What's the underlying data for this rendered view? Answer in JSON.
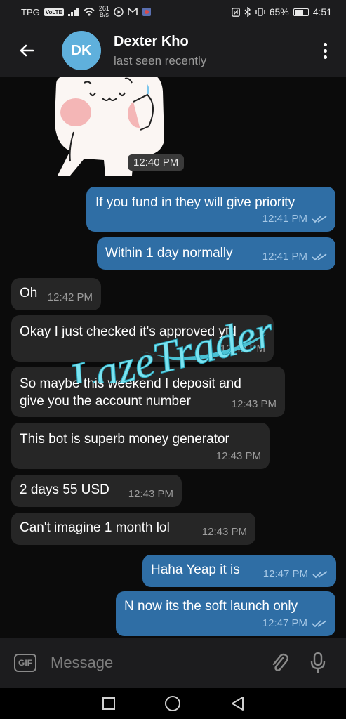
{
  "status_bar": {
    "carrier": "TPG",
    "volte": "VoLTE",
    "speed_value": "261",
    "speed_unit": "B/s",
    "battery": "65%",
    "time": "4:51"
  },
  "header": {
    "avatar_initials": "DK",
    "name": "Dexter Kho",
    "status": "last seen recently"
  },
  "colors": {
    "header_bg": "#1c1c1e",
    "chat_bg": "#0b0b0b",
    "outgoing_bubble": "#2f6ea5",
    "incoming_bubble": "#262626",
    "avatar": "#5fb0dc",
    "watermark": "#5ad6e6"
  },
  "sticker": {
    "time": "12:40 PM"
  },
  "messages": [
    {
      "direction": "out",
      "text": "If you fund in they will give priority",
      "time": "12:41 PM"
    },
    {
      "direction": "out",
      "text": "Within 1 day normally",
      "time": "12:41 PM"
    },
    {
      "direction": "in",
      "text": "Oh",
      "time": "12:42 PM"
    },
    {
      "direction": "in",
      "text": "Okay I just checked it's approved ytd",
      "time": "12:42 PM"
    },
    {
      "direction": "in",
      "text": "So maybe this weekend I deposit and give you the account number",
      "time": "12:43 PM"
    },
    {
      "direction": "in",
      "text": "This bot is superb money generator",
      "time": "12:43 PM"
    },
    {
      "direction": "in",
      "text": "2 days 55 USD",
      "time": "12:43 PM"
    },
    {
      "direction": "in",
      "text": "Can't imagine 1 month lol",
      "time": "12:43 PM"
    },
    {
      "direction": "out",
      "text": "Haha Yeap it is",
      "time": "12:47 PM"
    },
    {
      "direction": "out",
      "text": "N now its the soft launch only",
      "time": "12:47 PM"
    }
  ],
  "watermark": {
    "text": "LazeTrader"
  },
  "input": {
    "gif_label": "GIF",
    "placeholder": "Message"
  },
  "icons": [
    "back-arrow-icon",
    "more-vert-icon",
    "gif-icon",
    "paperclip-icon",
    "microphone-icon",
    "read-double-check-icon",
    "nav-recents-icon",
    "nav-home-icon",
    "nav-back-icon"
  ]
}
